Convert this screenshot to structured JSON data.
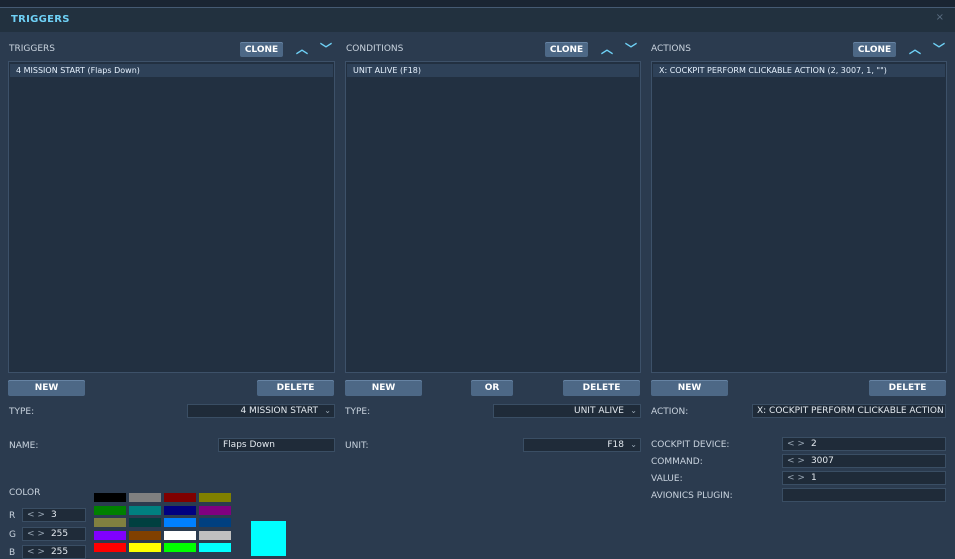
{
  "window": {
    "title": "TRIGGERS",
    "close_glyph": "×"
  },
  "panels": {
    "triggers": {
      "header": "TRIGGERS",
      "clone": "CLONE",
      "items": [
        "4 MISSION START (Flaps Down)"
      ],
      "new": "NEW",
      "delete": "DELETE"
    },
    "conditions": {
      "header": "CONDITIONS",
      "clone": "CLONE",
      "items": [
        "UNIT ALIVE (F18)"
      ],
      "new": "NEW",
      "or": "OR",
      "delete": "DELETE"
    },
    "actions": {
      "header": "ACTIONS",
      "clone": "CLONE",
      "items": [
        "X: COCKPIT PERFORM CLICKABLE ACTION (2, 3007, 1, \"\")"
      ],
      "new": "NEW",
      "delete": "DELETE"
    }
  },
  "trigger_props": {
    "type_label": "TYPE:",
    "type_value": "4 MISSION START",
    "name_label": "NAME:",
    "name_value": "Flaps Down"
  },
  "condition_props": {
    "type_label": "TYPE:",
    "type_value": "UNIT ALIVE",
    "unit_label": "UNIT:",
    "unit_value": "F18"
  },
  "action_props": {
    "action_label": "ACTION:",
    "action_value": "X: COCKPIT PERFORM CLICKABLE ACTION",
    "device_label": "COCKPIT DEVICE:",
    "device_value": "2",
    "command_label": "COMMAND:",
    "command_value": "3007",
    "value_label": "VALUE:",
    "value_value": "1",
    "plugin_label": "AVIONICS PLUGIN:",
    "plugin_value": ""
  },
  "color": {
    "label": "COLOR",
    "r_label": "R",
    "r_value": "3",
    "g_label": "G",
    "g_value": "255",
    "b_label": "B",
    "b_value": "255",
    "spin_arrows": "< >",
    "preview_color": "#00ffff",
    "palette": [
      "#000000",
      "#808080",
      "#800000",
      "#808000",
      "#008000",
      "#008080",
      "#000080",
      "#800080",
      "#808040",
      "#004040",
      "#0080ff",
      "#004080",
      "#8000ff",
      "#804000",
      "#ffffff",
      "#c0c0c0",
      "#ff0000",
      "#ffff00",
      "#00ff00",
      "#00ffff"
    ]
  },
  "icons": {
    "up": "▲",
    "down": "▼",
    "chevron": "⌵"
  }
}
